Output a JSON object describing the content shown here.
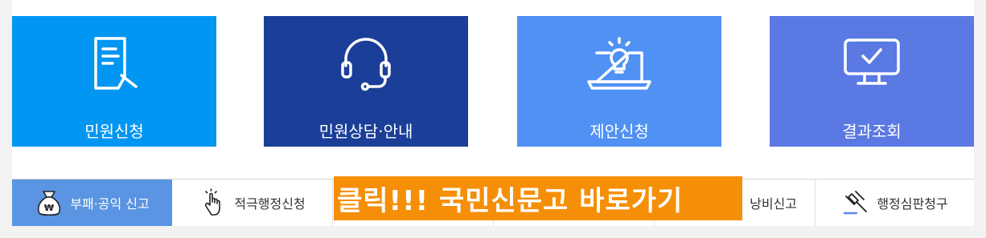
{
  "colors": {
    "tile_1": "#0196f2",
    "tile_2": "#1b3e98",
    "tile_3": "#5091f4",
    "tile_4": "#5a79e2",
    "bottom_active": "#5a94e2",
    "banner": "#f58f07",
    "icon_accent": "#5b87ea"
  },
  "tiles": [
    {
      "label": "민원신청",
      "icon": "document-pen-icon"
    },
    {
      "label": "민원상담·안내",
      "icon": "headset-icon"
    },
    {
      "label": "제안신청",
      "icon": "laptop-lightbulb-icon"
    },
    {
      "label": "결과조회",
      "icon": "monitor-check-icon"
    }
  ],
  "bottom_menu": [
    {
      "label": "부패·공익 신고",
      "icon": "money-bag-icon"
    },
    {
      "label": "적극행정신청",
      "icon": "hand-pointer-icon"
    },
    {
      "label": "",
      "icon": ""
    },
    {
      "label": "",
      "icon": ""
    },
    {
      "label": "낭비신고",
      "icon": ""
    },
    {
      "label": "행정심판청구",
      "icon": "gavel-icon"
    }
  ],
  "banner": {
    "text": "클릭!!! 국민신문고 바로가기"
  }
}
